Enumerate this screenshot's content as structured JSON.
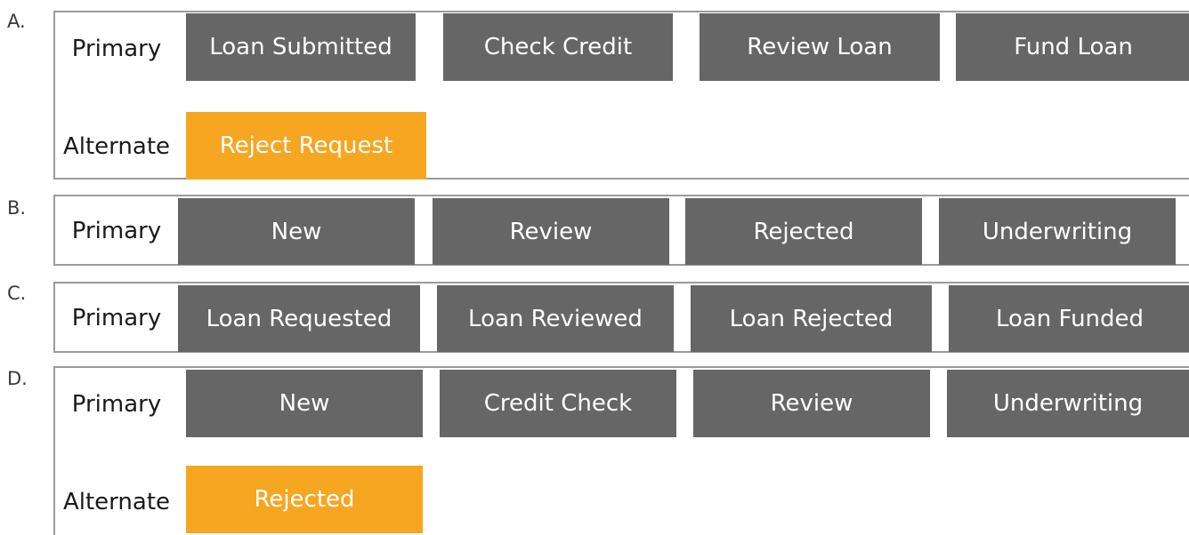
{
  "options": [
    {
      "letter": "A.",
      "primary_label": "Primary",
      "alternate_label": "Alternate",
      "primary_stages": [
        "Loan Submitted",
        "Check Credit",
        "Review Loan",
        "Fund Loan"
      ],
      "alternate_stages": [
        "Reject Request"
      ]
    },
    {
      "letter": "B.",
      "primary_label": "Primary",
      "primary_stages": [
        "New",
        "Review",
        "Rejected",
        "Underwriting"
      ]
    },
    {
      "letter": "C.",
      "primary_label": "Primary",
      "primary_stages": [
        "Loan Requested",
        "Loan Reviewed",
        "Loan Rejected",
        "Loan Funded"
      ]
    },
    {
      "letter": "D.",
      "primary_label": "Primary",
      "alternate_label": "Alternate",
      "primary_stages": [
        "New",
        "Credit Check",
        "Review",
        "Underwriting"
      ],
      "alternate_stages": [
        "Rejected"
      ]
    }
  ],
  "colors": {
    "primary_stage": "#666666",
    "alternate_stage": "#f6a621",
    "stage_text": "#ffffff",
    "panel_border": "#9b9b9b"
  }
}
